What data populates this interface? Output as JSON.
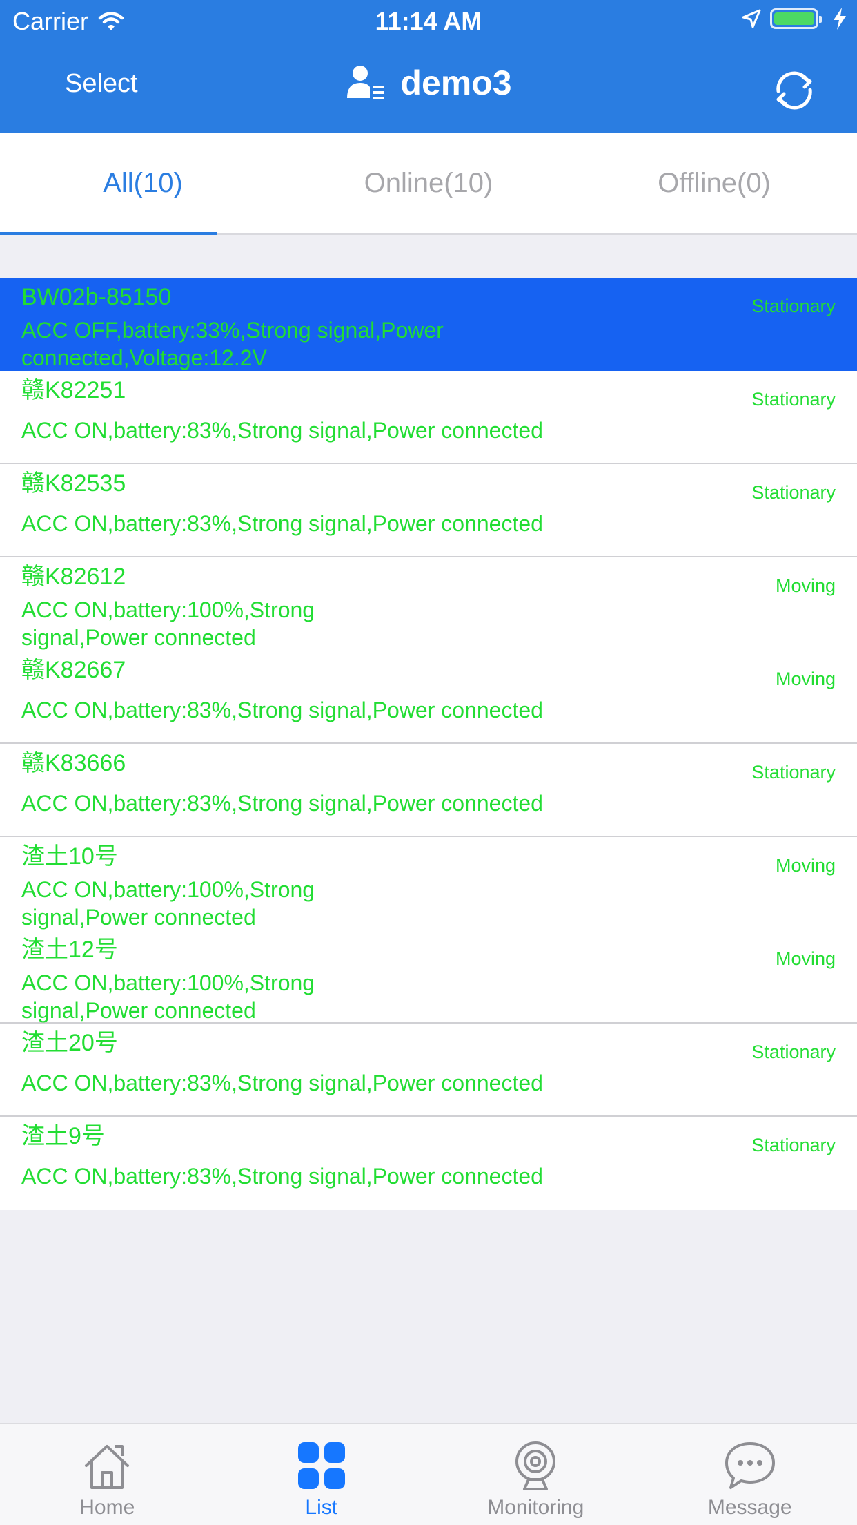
{
  "status_bar": {
    "carrier": "Carrier",
    "time": "11:14 AM"
  },
  "nav": {
    "select_label": "Select",
    "title": "demo3"
  },
  "tabs": [
    {
      "label": "All(10)",
      "active": true
    },
    {
      "label": "Online(10)",
      "active": false
    },
    {
      "label": "Offline(0)",
      "active": false
    }
  ],
  "devices": [
    {
      "name": "BW02b-85150",
      "status": "Stationary",
      "info": "ACC OFF,battery:33%,Strong signal,Power connected,Voltage:12.2V"
    },
    {
      "name": "赣K82251",
      "status": "Stationary",
      "info": "ACC ON,battery:83%,Strong signal,Power connected"
    },
    {
      "name": "赣K82535",
      "status": "Stationary",
      "info": "ACC ON,battery:83%,Strong signal,Power connected"
    },
    {
      "name": "赣K82612",
      "status": "Moving",
      "info": "ACC ON,battery:100%,Strong signal,Power connected"
    },
    {
      "name": "赣K82667",
      "status": "Moving",
      "info": "ACC ON,battery:83%,Strong signal,Power connected"
    },
    {
      "name": "赣K83666",
      "status": "Stationary",
      "info": "ACC ON,battery:83%,Strong signal,Power connected"
    },
    {
      "name": "渣土10号",
      "status": "Moving",
      "info": "ACC ON,battery:100%,Strong signal,Power connected"
    },
    {
      "name": "渣土12号",
      "status": "Moving",
      "info": "ACC ON,battery:100%,Strong signal,Power connected"
    },
    {
      "name": "渣土20号",
      "status": "Stationary",
      "info": "ACC ON,battery:83%,Strong signal,Power connected"
    },
    {
      "name": "渣土9号",
      "status": "Stationary",
      "info": "ACC ON,battery:83%,Strong signal,Power connected"
    }
  ],
  "tabbar": [
    {
      "label": "Home",
      "icon": "home-icon"
    },
    {
      "label": "List",
      "icon": "grid-icon"
    },
    {
      "label": "Monitoring",
      "icon": "camera-icon"
    },
    {
      "label": "Message",
      "icon": "chat-bubble-icon"
    }
  ],
  "colors": {
    "nav_blue": "#2a7de1",
    "selected_row": "#1662f2",
    "status_green": "#22dd33",
    "tab_active": "#1677ff"
  }
}
